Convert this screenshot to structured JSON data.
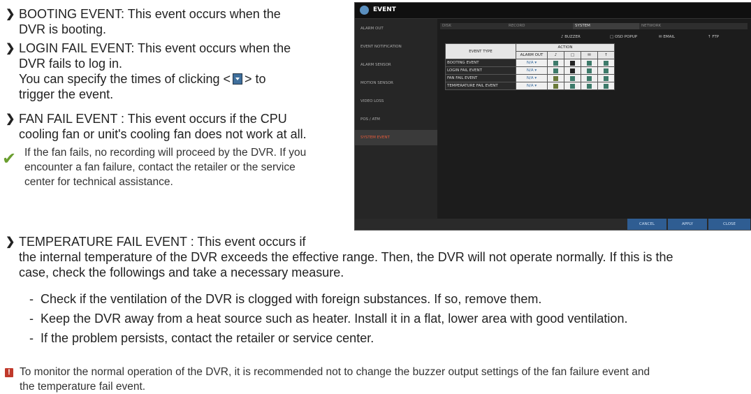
{
  "bullets": {
    "booting": {
      "line1": "BOOTING EVENT: This event occurs when the",
      "line2": "DVR is booting."
    },
    "login": {
      "line1": "LOGIN FAIL EVENT: This event occurs when the",
      "line2": "DVR fails to log in.",
      "line3_a": "You can specify the times of clicking <",
      "line3_b": "> to",
      "line4": "trigger the event."
    },
    "fan": {
      "line1": "FAN FAIL EVENT : This event occurs if the CPU",
      "line2": "cooling fan or unit's cooling fan does not work at all."
    },
    "fan_note": {
      "line1": "If the fan fails, no recording will proceed by the DVR. If you",
      "line2": "encounter a fan failure, contact the retailer or the service",
      "line3": "center for technical assistance."
    },
    "temp": {
      "line1": "TEMPERATURE FAIL EVENT : This event occurs if",
      "line2": "the internal temperature of the DVR exceeds the effective range. Then, the DVR will not operate normally. If this is the",
      "line3": "case, check the followings and take a necessary measure."
    },
    "checks": [
      "Check if the ventilation of the DVR is clogged with foreign substances. If so, remove them.",
      "Keep the DVR away from a heat source such as heater. Install it in a flat, lower area with good ventilation.",
      "If the problem persists, contact the retailer or service center."
    ],
    "final_note": {
      "line1": "To monitor the normal operation of the DVR, it is recommended not to change the buzzer output settings of the fan failure event and",
      "line2": "the temperature fail event."
    }
  },
  "dvr": {
    "title": "EVENT",
    "sidebar": [
      "ALARM OUT",
      "EVENT NOTIFICATION",
      "ALARM SENSOR",
      "MOTION SENSOR",
      "VIDEO LOSS",
      "POS / ATM",
      "SYSTEM EVENT"
    ],
    "active_sidebar": "SYSTEM EVENT",
    "tabs": [
      "DISK",
      "RECORD",
      "SYSTEM",
      "NETWORK"
    ],
    "active_tab": "SYSTEM",
    "legend": {
      "buzzer": "BUZZER",
      "osd": "OSD POPUP",
      "email": "EMAIL",
      "ftp": "FTP"
    },
    "table": {
      "header_event": "EVENT TYPE",
      "header_action": "ACTION",
      "header_alarm": "ALARM OUT",
      "rows": [
        {
          "name": "BOOTING EVENT",
          "alarm": "N/A"
        },
        {
          "name": "LOGIN FAIL EVENT",
          "alarm": "N/A"
        },
        {
          "name": "FAN FAIL EVENT",
          "alarm": "N/A"
        },
        {
          "name": "TEMPERATURE FAIL EVENT",
          "alarm": "N/A"
        }
      ]
    },
    "buttons": {
      "cancel": "CANCEL",
      "apply": "APPLY",
      "close": "CLOSE"
    }
  },
  "icons": {
    "bullet": "chevron-right-icon",
    "check": "checkmark-icon",
    "warning": "exclamation-icon"
  }
}
